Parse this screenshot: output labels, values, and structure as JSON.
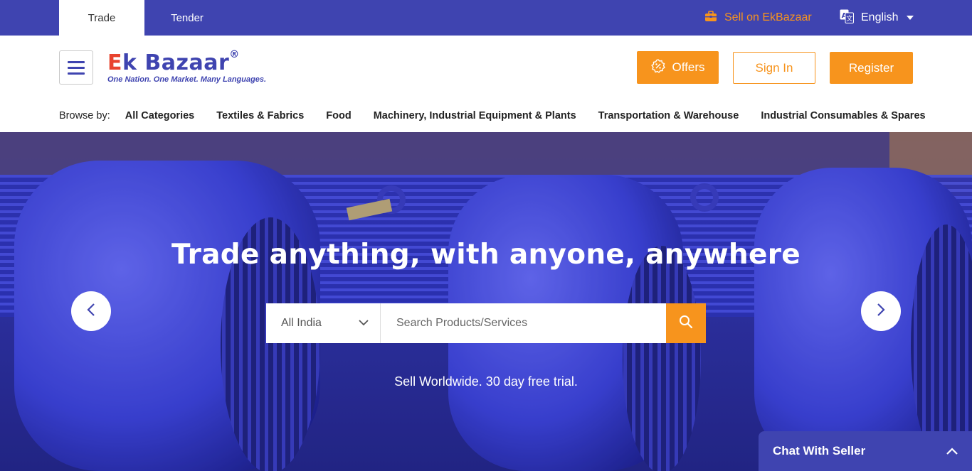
{
  "topbar": {
    "tabs": [
      {
        "label": "Trade",
        "active": true
      },
      {
        "label": "Tender",
        "active": false
      }
    ],
    "sell_link": "Sell on EkBazaar",
    "language": "English",
    "bg_color": "#3f44b0",
    "accent_color": "#f7941d"
  },
  "header": {
    "logo": {
      "text_first": "E",
      "text_rest": "k Bazaar",
      "registered": "®",
      "tagline": "One Nation. One Market. Many Languages."
    },
    "offers_label": "Offers",
    "signin_label": "Sign In",
    "register_label": "Register"
  },
  "browse": {
    "label": "Browse by:",
    "items": [
      "All Categories",
      "Textiles & Fabrics",
      "Food",
      "Machinery, Industrial Equipment & Plants",
      "Transportation & Warehouse",
      "Industrial Consumables & Spares"
    ]
  },
  "hero": {
    "title": "Trade anything, with anyone, anywhere",
    "location": "All India",
    "search_placeholder": "Search Products/Services",
    "subtitle": "Sell Worldwide. 30 day free trial."
  },
  "chat": {
    "label": "Chat With Seller"
  }
}
